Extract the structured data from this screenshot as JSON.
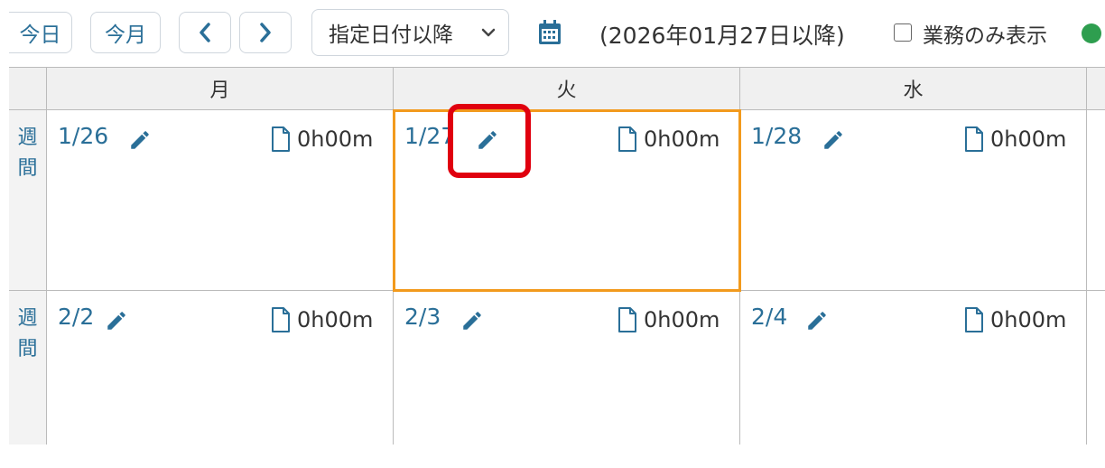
{
  "toolbar": {
    "today_label": "今日",
    "this_month_label": "今月",
    "range_select_value": "指定日付以降",
    "range_text": "(2026年01月27日以降)",
    "business_only_label": "業務のみ表示",
    "business_only_checked": false
  },
  "calendar": {
    "weekday_headers": [
      "月",
      "火",
      "水"
    ],
    "week_label": "週間",
    "weeks": [
      {
        "days": [
          {
            "date": "1/26",
            "hours": "0h00m"
          },
          {
            "date": "1/27",
            "hours": "0h00m",
            "selected": true
          },
          {
            "date": "1/28",
            "hours": "0h00m"
          }
        ]
      },
      {
        "days": [
          {
            "date": "2/2",
            "hours": "0h00m"
          },
          {
            "date": "2/3",
            "hours": "0h00m"
          },
          {
            "date": "2/4",
            "hours": "0h00m"
          }
        ]
      }
    ]
  },
  "colors": {
    "accent": "#2a6f98",
    "selected_border": "#f29a1d",
    "highlight": "#e0000f"
  }
}
